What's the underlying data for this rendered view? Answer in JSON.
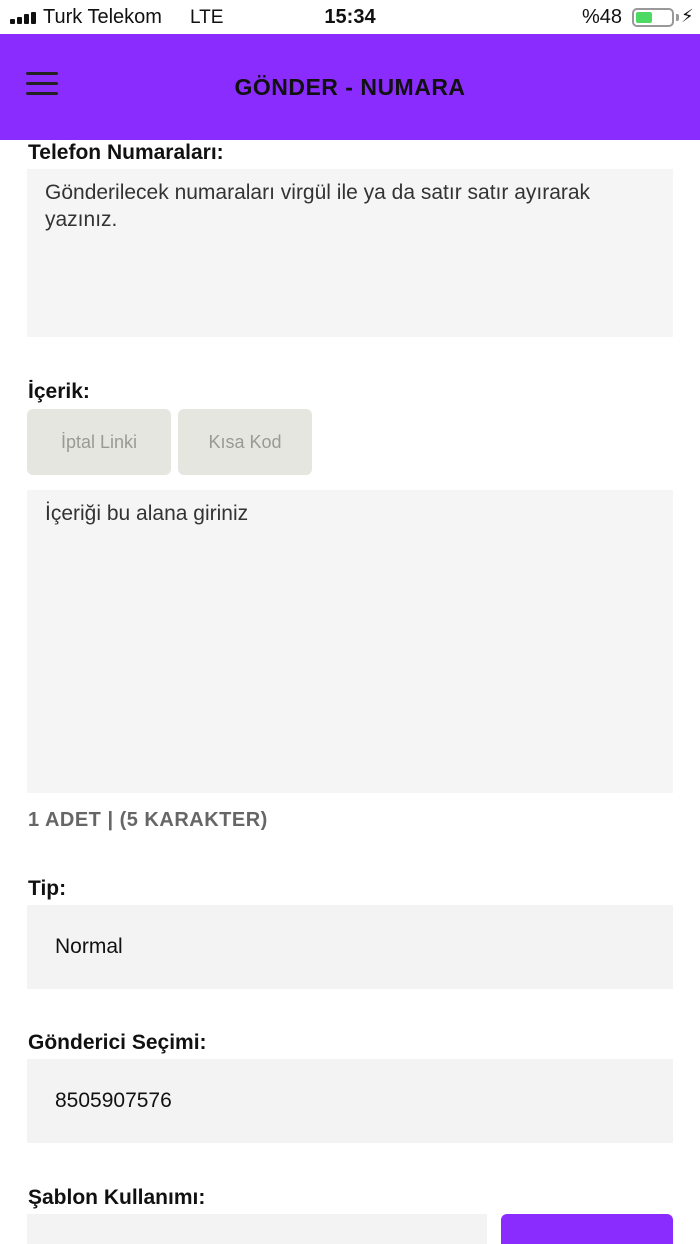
{
  "status_bar": {
    "carrier": "Turk Telekom",
    "network": "LTE",
    "time": "15:34",
    "battery_percent": "%48",
    "battery_level": 0.48,
    "battery_color": "#4cd964"
  },
  "header": {
    "title": "GÖNDER - NUMARA",
    "menu_icon": "hamburger-icon",
    "background_color": "#8b2cff"
  },
  "form": {
    "phone_numbers": {
      "label": "Telefon Numaraları:",
      "placeholder": "Gönderilecek numaraları virgül ile ya da satır satır ayırarak yazınız."
    },
    "content": {
      "label": "İçerik:",
      "buttons": [
        "İptal Linki",
        "Kısa Kod"
      ],
      "placeholder": "İçeriği bu alana giriniz",
      "counter": "1 ADET | (5 KARAKTER)"
    },
    "type": {
      "label": "Tip:",
      "value": "Normal"
    },
    "sender": {
      "label": "Gönderici Seçimi:",
      "value": "8505907576"
    },
    "template": {
      "label": "Şablon Kullanımı:"
    }
  }
}
